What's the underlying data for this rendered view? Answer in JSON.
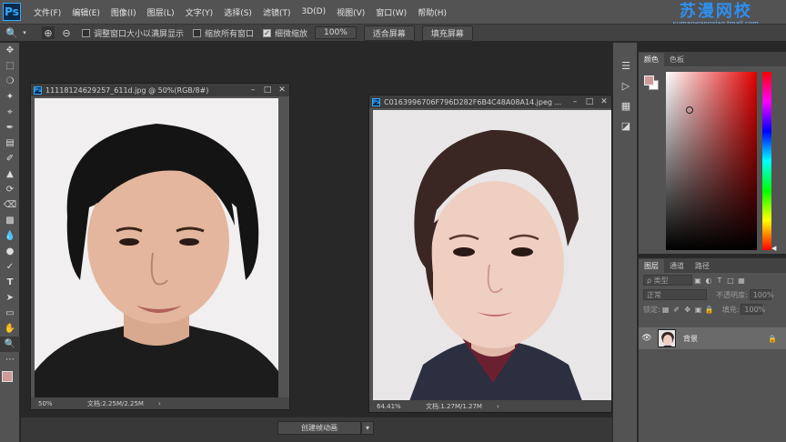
{
  "app": {
    "logo": "Ps"
  },
  "menu": [
    "文件(F)",
    "编辑(E)",
    "图像(I)",
    "图层(L)",
    "文字(Y)",
    "选择(S)",
    "滤镜(T)",
    "3D(D)",
    "视图(V)",
    "窗口(W)",
    "帮助(H)"
  ],
  "watermark": {
    "title": "苏漫网校",
    "subtitle": "sumanwangxiao.tmall.com"
  },
  "options": {
    "resize_windows": "调整窗口大小以满屏显示",
    "zoom_all": "缩放所有窗口",
    "scrubby_zoom": "细微缩放",
    "zoom_value": "100%",
    "fit_screen": "适合屏幕",
    "fill_screen": "填充屏幕"
  },
  "doc1": {
    "title": "11118124629257_611d.jpg @ 50%(RGB/8#)",
    "zoom": "50%",
    "info": "文档:2.25M/2.25M"
  },
  "doc2": {
    "title": "C0163996706F796D282F6B4C48A08A14.jpeg ...",
    "zoom": "64.41%",
    "info": "文档:1.27M/1.27M"
  },
  "timeline": {
    "button": "创建帧动画"
  },
  "color_panel": {
    "tabs": [
      "颜色",
      "色板"
    ],
    "foreground": "#d19a98"
  },
  "layers_panel": {
    "tabs": [
      "图层",
      "通道",
      "路径"
    ],
    "filter_placeholder": "ρ 类型",
    "blend_mode": "正常",
    "opacity_label": "不透明度:",
    "opacity_value": "100%",
    "lock_label": "锁定:",
    "fill_label": "填充:",
    "fill_value": "100%",
    "layer_name": "背景"
  }
}
